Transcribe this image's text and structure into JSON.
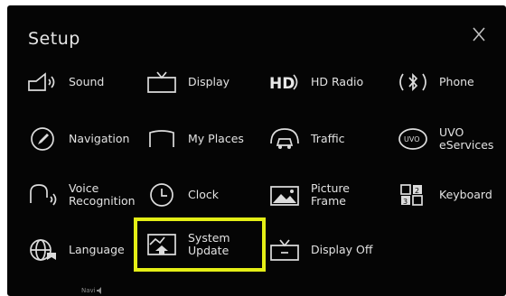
{
  "screen": {
    "title": "Setup",
    "close_icon": "close-x-icon",
    "status": "Navi"
  },
  "menu": [
    {
      "id": "sound",
      "label": "Sound",
      "icon": "sound-icon"
    },
    {
      "id": "display",
      "label": "Display",
      "icon": "display-icon"
    },
    {
      "id": "hd-radio",
      "label": "HD Radio",
      "icon": "hd-radio-icon"
    },
    {
      "id": "phone",
      "label": "Phone",
      "icon": "bluetooth-phone-icon"
    },
    {
      "id": "navigation",
      "label": "Navigation",
      "icon": "navigation-icon"
    },
    {
      "id": "my-places",
      "label": "My Places",
      "icon": "my-places-icon"
    },
    {
      "id": "traffic",
      "label": "Traffic",
      "icon": "traffic-icon"
    },
    {
      "id": "uvo",
      "label": "UVO\neServices",
      "icon": "uvo-icon"
    },
    {
      "id": "voice",
      "label": "Voice\nRecognition",
      "icon": "voice-recognition-icon"
    },
    {
      "id": "clock",
      "label": "Clock",
      "icon": "clock-icon"
    },
    {
      "id": "picture-frame",
      "label": "Picture\nFrame",
      "icon": "picture-frame-icon"
    },
    {
      "id": "keyboard",
      "label": "Keyboard",
      "icon": "keyboard-icon"
    },
    {
      "id": "language",
      "label": "Language",
      "icon": "language-icon"
    },
    {
      "id": "system-update",
      "label": "System\nUpdate",
      "icon": "system-update-icon",
      "highlighted": true
    },
    {
      "id": "display-off",
      "label": "Display Off",
      "icon": "display-off-icon"
    }
  ],
  "colors": {
    "background": "#050505",
    "text": "#e2e2e2",
    "highlight": "#e4ee16"
  }
}
